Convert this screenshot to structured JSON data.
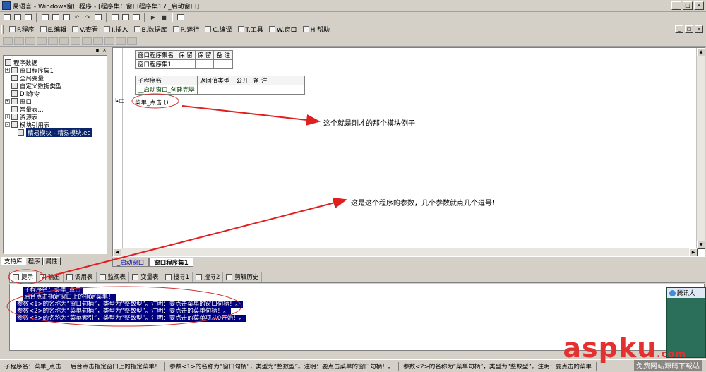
{
  "window": {
    "title": "易语言 - Windows窗口程序 - [程序集：窗口程序集1 / _启动窗口]",
    "min": "_",
    "max": "□",
    "close": "×"
  },
  "menu": [
    "F.程序",
    "E.编辑",
    "V.查看",
    "I.插入",
    "B.数据库",
    "R.运行",
    "C.编译",
    "T.工具",
    "W.窗口",
    "H.帮助"
  ],
  "tree": {
    "root": "程序数据",
    "items": [
      {
        "label": "窗口程序集1",
        "expand": "+",
        "indent": 1
      },
      {
        "label": "全局变量",
        "expand": "",
        "indent": 1
      },
      {
        "label": "自定义数据类型",
        "expand": "",
        "indent": 1
      },
      {
        "label": "Dll命令",
        "expand": "",
        "indent": 1
      },
      {
        "label": "窗口",
        "expand": "+",
        "indent": 1
      },
      {
        "label": "常量表...",
        "expand": "",
        "indent": 1
      },
      {
        "label": "资源表",
        "expand": "+",
        "indent": 1
      },
      {
        "label": "模块引用表",
        "expand": "-",
        "indent": 1
      },
      {
        "label": "精易模块 - 精易模块.ec",
        "expand": "",
        "indent": 2,
        "selected": true
      }
    ]
  },
  "left_tabs": [
    "支持库",
    "程序",
    "属性"
  ],
  "editor": {
    "table1": {
      "headers": [
        "窗口程序集名",
        "保 留",
        "保 留",
        "备 注"
      ],
      "row": [
        "窗口程序集1",
        "",
        "",
        ""
      ]
    },
    "table2": {
      "headers": [
        "子程序名",
        "返回值类型",
        "公开",
        "备 注"
      ],
      "row": [
        "__启动窗口_创建完毕",
        "",
        "",
        ""
      ]
    },
    "callout_line": "菜单_点击 ()"
  },
  "doc_tabs": [
    "_启动窗口",
    "窗口程序集1"
  ],
  "bottom_tabs": [
    "提示",
    "输出",
    "调用表",
    "监视表",
    "变量表",
    "搜寻1",
    "搜寻2",
    "剪辑历史"
  ],
  "output_lines": [
    "子程序名：菜单_点击",
    "后台点击指定窗口上的指定菜单！",
    "参数<1>的名称为“窗口句柄”，类型为“整数型”。注明：要点击菜单的窗口句柄！。",
    "参数<2>的名称为“菜单句柄”，类型为“整数型”。注明：要点击的菜单句柄！。",
    "参数<3>的名称为“菜单索引”，类型为“整数型”。注明：要点击的菜单项从0开始！。"
  ],
  "status": [
    "子程序名：菜单_点击",
    "后台点击指定窗口上的指定菜单！",
    "参数<1>的名称为“窗口句柄”，类型为“整数型”。注明：要点击菜单的窗口句柄！。",
    "参数<2>的名称为“菜单句柄”，类型为“整数型”。注明：要点击的菜单"
  ],
  "annotations": {
    "a1": "这个就是刚才的那个模块例子",
    "a2": "这是这个程序的参数，几个参数就点几个逗号！！"
  },
  "ad": {
    "head": "腾讯大"
  },
  "watermark": {
    "a": "asp",
    "k": "ku",
    "dot": ".com",
    "sub": "免费网站源码下载站"
  },
  "colors": {
    "arrow": "#e02020",
    "highlight": "#000080",
    "brand": "#e53030"
  }
}
